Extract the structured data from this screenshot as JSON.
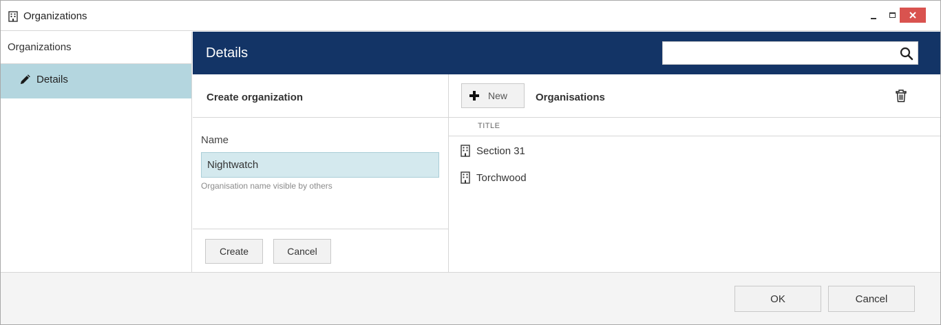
{
  "window": {
    "title": "Organizations",
    "close_color": "#d9534f"
  },
  "sidebar": {
    "header": "Organizations",
    "items": [
      {
        "label": "Details",
        "icon": "pencil-icon",
        "selected": true
      }
    ],
    "selected_color": "#b4d6df"
  },
  "details": {
    "title": "Details",
    "header_color": "#133466",
    "search": {
      "value": "",
      "placeholder": ""
    }
  },
  "create_panel": {
    "title": "Create organization",
    "name_label": "Name",
    "name_value": "Nightwatch",
    "name_hint": "Organisation name visible by others",
    "create_label": "Create",
    "cancel_label": "Cancel"
  },
  "list_panel": {
    "new_label": "New",
    "title": "Organisations",
    "column_title": "TITLE",
    "rows": [
      {
        "title": "Section 31",
        "icon": "building-icon"
      },
      {
        "title": "Torchwood",
        "icon": "building-icon"
      }
    ]
  },
  "footer": {
    "ok_label": "OK",
    "cancel_label": "Cancel"
  }
}
